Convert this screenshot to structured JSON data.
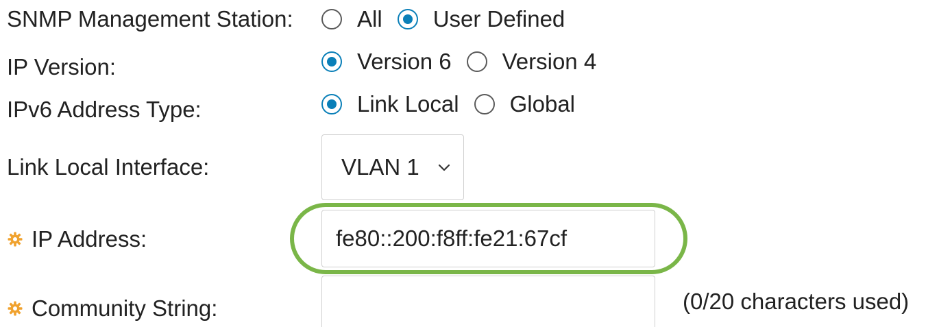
{
  "snmp_station": {
    "label": "SNMP Management Station:",
    "options": [
      {
        "label": "All",
        "checked": false
      },
      {
        "label": "User Defined",
        "checked": true
      }
    ]
  },
  "ip_version": {
    "label": "IP Version:",
    "options": [
      {
        "label": "Version 6",
        "checked": true
      },
      {
        "label": "Version 4",
        "checked": false
      }
    ]
  },
  "ipv6_address_type": {
    "label": "IPv6 Address Type:",
    "options": [
      {
        "label": "Link Local",
        "checked": true
      },
      {
        "label": "Global",
        "checked": false
      }
    ]
  },
  "link_local_interface": {
    "label": "Link Local Interface:",
    "selected": "VLAN 1"
  },
  "ip_address": {
    "label": "IP Address:",
    "value": "fe80::200:f8ff:fe21:67cf"
  },
  "community_string": {
    "label": "Community String:",
    "value": "",
    "hint": "(0/20 characters used)"
  },
  "colors": {
    "radio_accent": "#0a7fb8",
    "highlight": "#7ab648",
    "required_icon": "#f0a22e"
  }
}
